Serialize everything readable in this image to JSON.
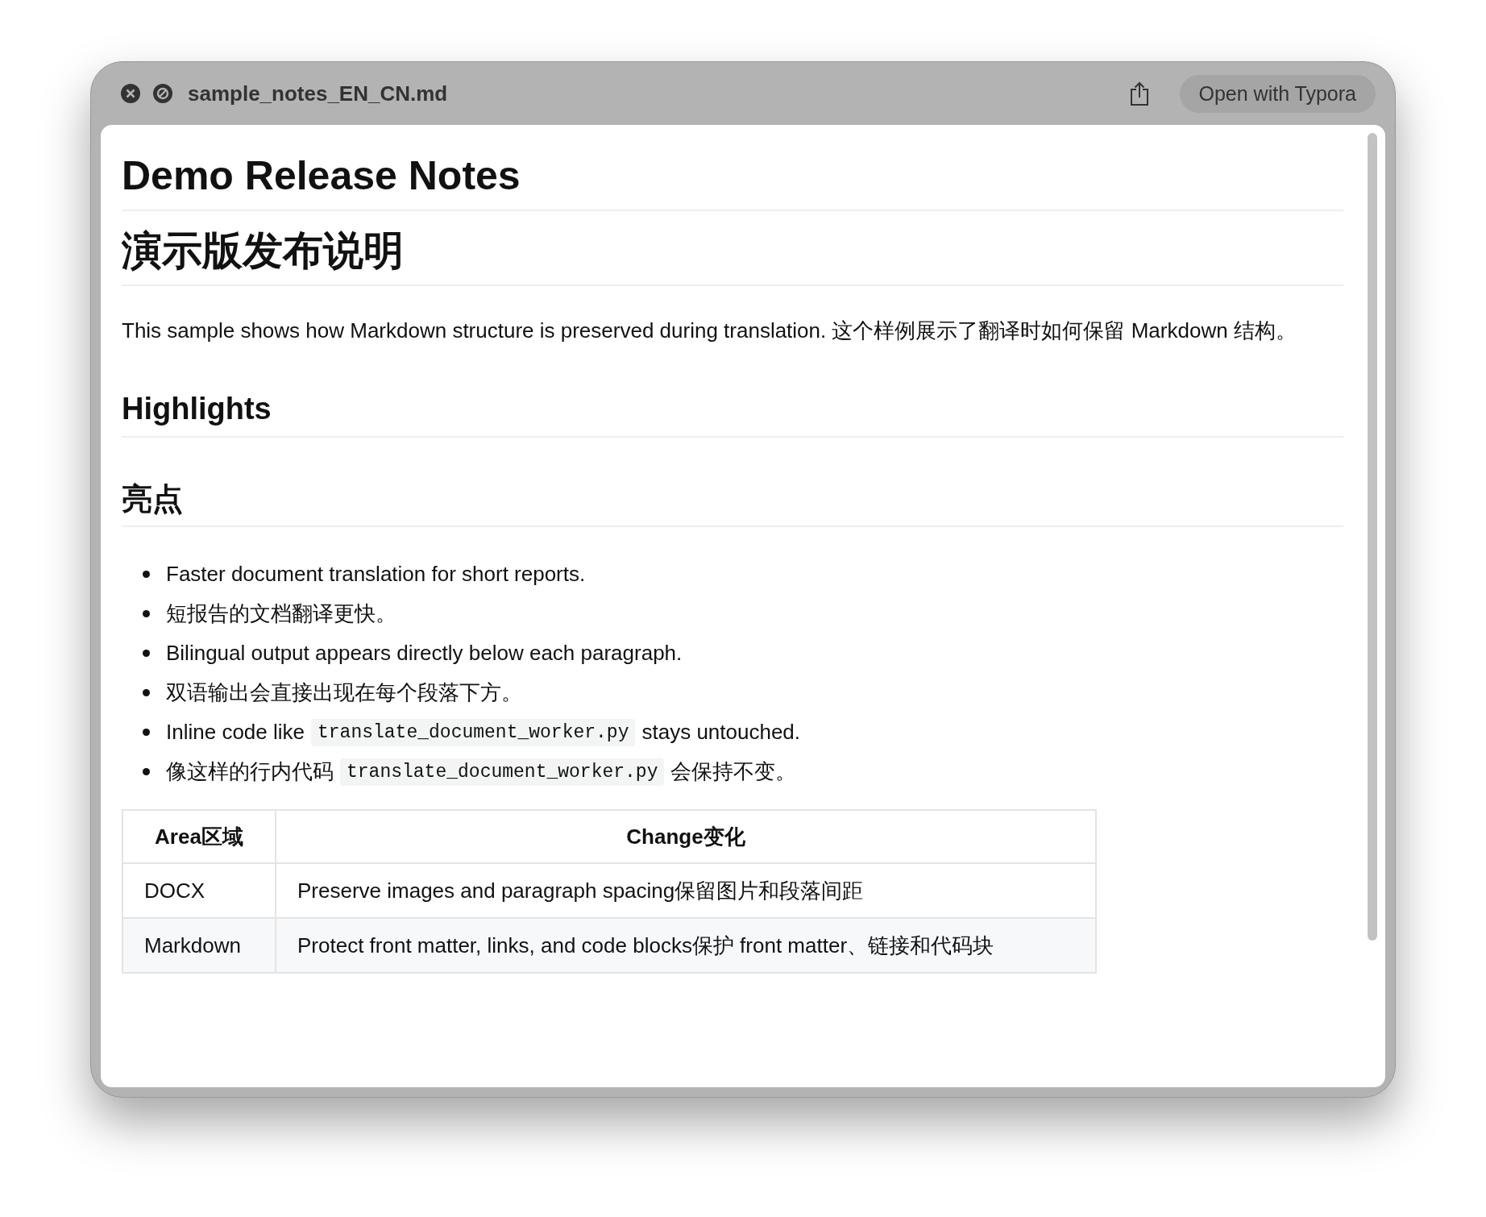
{
  "window": {
    "title": "sample_notes_EN_CN.md",
    "open_button": "Open with Typora"
  },
  "document": [
    {
      "kind": "h1",
      "text": "Demo Release Notes"
    },
    {
      "kind": "h1",
      "text": "演示版发布说明"
    },
    {
      "kind": "p",
      "text": "This sample shows how Markdown structure is preserved during translation. 这个样例展示了翻译时如何保留 Markdown 结构。"
    },
    {
      "kind": "h2",
      "text": "Highlights"
    },
    {
      "kind": "h2",
      "text": "亮点"
    },
    {
      "kind": "list",
      "items": [
        {
          "parts": [
            {
              "kind": "text",
              "text": "Faster document translation for short reports."
            }
          ]
        },
        {
          "parts": [
            {
              "kind": "text",
              "text": "短报告的文档翻译更快。"
            }
          ]
        },
        {
          "parts": [
            {
              "kind": "text",
              "text": "Bilingual output appears directly below each paragraph."
            }
          ]
        },
        {
          "parts": [
            {
              "kind": "text",
              "text": "双语输出会直接出现在每个段落下方。"
            }
          ]
        },
        {
          "parts": [
            {
              "kind": "text",
              "text": "Inline code like"
            },
            {
              "kind": "code",
              "text": "translate_document_worker.py"
            },
            {
              "kind": "text",
              "text": "stays untouched."
            }
          ]
        },
        {
          "parts": [
            {
              "kind": "text",
              "text": "像这样的行内代码"
            },
            {
              "kind": "code",
              "text": "translate_document_worker.py"
            },
            {
              "kind": "text",
              "text": "会保持不变。"
            }
          ]
        }
      ]
    },
    {
      "kind": "table",
      "columns": [
        "Area区域",
        "Change变化"
      ],
      "rows": [
        [
          "DOCX",
          "Preserve images and paragraph spacing保留图片和段落间距"
        ],
        [
          "Markdown",
          "Protect front matter, links, and code blocks保护 front matter、链接和代码块"
        ]
      ]
    }
  ]
}
